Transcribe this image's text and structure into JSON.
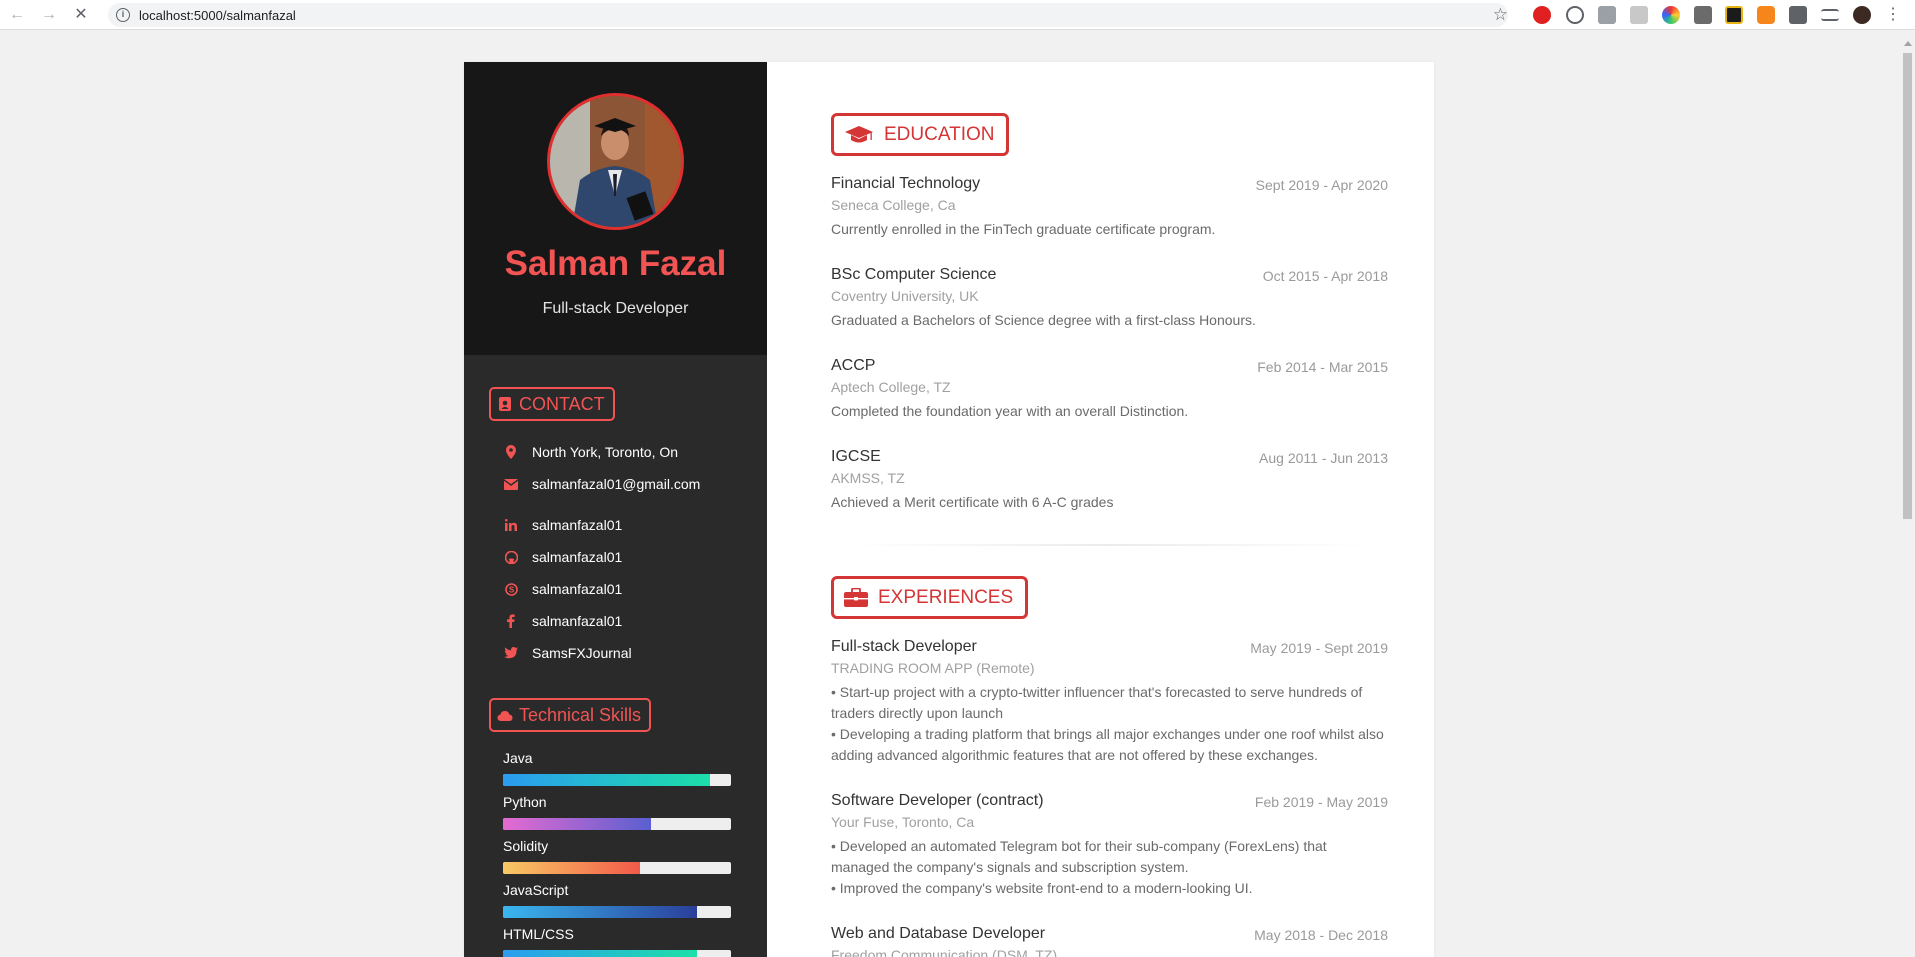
{
  "browser": {
    "url": "localhost:5000/salmanfazal"
  },
  "profile": {
    "name": "Salman Fazal",
    "role": "Full-stack Developer"
  },
  "contact": {
    "heading": "CONTACT",
    "items": [
      {
        "icon": "location-pin-icon",
        "text": "North York, Toronto, On"
      },
      {
        "icon": "envelope-icon",
        "text": "salmanfazal01@gmail.com"
      },
      {
        "icon": "linkedin-icon",
        "text": "salmanfazal01"
      },
      {
        "icon": "github-icon",
        "text": "salmanfazal01"
      },
      {
        "icon": "skype-icon",
        "text": "salmanfazal01"
      },
      {
        "icon": "facebook-icon",
        "text": "salmanfazal01"
      },
      {
        "icon": "twitter-icon",
        "text": "SamsFXJournal"
      }
    ]
  },
  "skills": {
    "heading": "Technical Skills",
    "items": [
      {
        "name": "Java",
        "level": 0.91,
        "colors": [
          "#2b9cf0",
          "#1ce0a8"
        ]
      },
      {
        "name": "Python",
        "level": 0.65,
        "colors": [
          "#e56bd1",
          "#5a5fd1"
        ]
      },
      {
        "name": "Solidity",
        "level": 0.6,
        "colors": [
          "#f9c964",
          "#f25a4a"
        ]
      },
      {
        "name": "JavaScript",
        "level": 0.85,
        "colors": [
          "#3ab7f0",
          "#2b3f9a"
        ]
      },
      {
        "name": "HTML/CSS",
        "level": 0.85,
        "colors": [
          "#2b9cf0",
          "#1ce0a8"
        ]
      }
    ]
  },
  "education": {
    "heading": "EDUCATION",
    "entries": [
      {
        "title": "Financial Technology",
        "date": "Sept 2019 - Apr 2020",
        "org": "Seneca College, Ca",
        "desc": [
          "Currently enrolled in the FinTech graduate certificate program."
        ]
      },
      {
        "title": "BSc Computer Science",
        "date": "Oct 2015 - Apr 2018",
        "org": "Coventry University, UK",
        "desc": [
          "Graduated a Bachelors of Science degree with a first-class Honours."
        ]
      },
      {
        "title": "ACCP",
        "date": "Feb 2014 - Mar 2015",
        "org": "Aptech College, TZ",
        "desc": [
          "Completed the foundation year with an overall Distinction."
        ]
      },
      {
        "title": "IGCSE",
        "date": "Aug 2011 - Jun 2013",
        "org": "AKMSS, TZ",
        "desc": [
          "Achieved a Merit certificate with 6 A-C grades"
        ]
      }
    ]
  },
  "experiences": {
    "heading": "EXPERIENCES",
    "entries": [
      {
        "title": "Full-stack Developer",
        "date": "May 2019 - Sept 2019",
        "org": "TRADING ROOM APP (Remote)",
        "desc": [
          "• Start-up project with a crypto-twitter influencer that's forecasted to serve hundreds of traders directly upon launch",
          "• Developing a trading platform that brings all major exchanges under one roof whilst also adding advanced algorithmic features that are not offered by these exchanges."
        ]
      },
      {
        "title": "Software Developer (contract)",
        "date": "Feb 2019 - May 2019",
        "org": "Your Fuse, Toronto, Ca",
        "desc": [
          "• Developed an automated Telegram bot for their sub-company (ForexLens) that managed the company's signals and subscription system.",
          "• Improved the company's website front-end to a modern-looking UI."
        ]
      },
      {
        "title": "Web and Database Developer",
        "date": "May 2018 - Dec 2018",
        "org": "Freedom Communication (DSM, TZ)",
        "desc": []
      }
    ]
  },
  "colors": {
    "accent": "#f25454",
    "section_accent": "#d43535",
    "sidebar_dark": "#171717",
    "sidebar": "#2a2a2a"
  }
}
